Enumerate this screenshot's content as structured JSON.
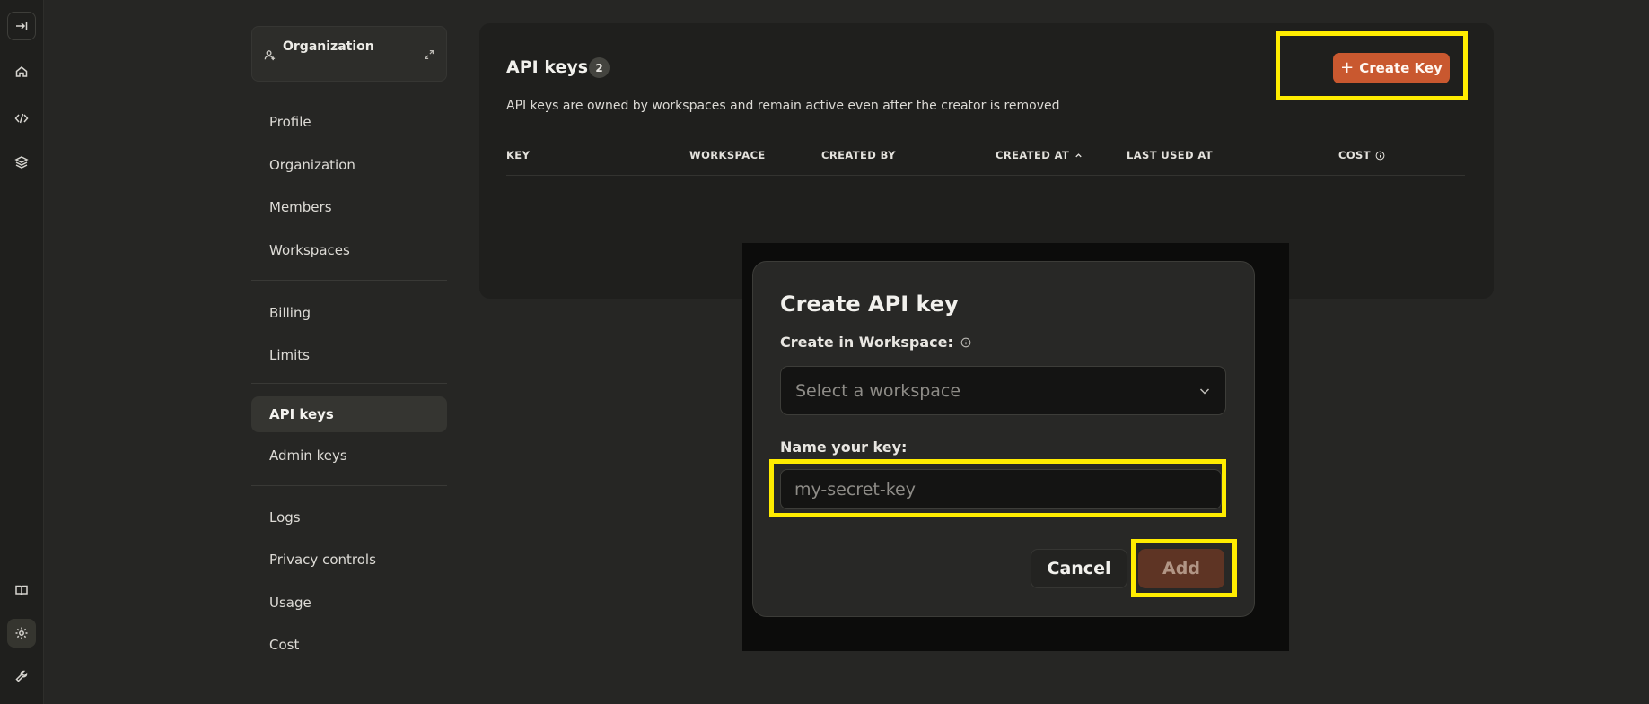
{
  "sidebar": {
    "org_switcher": {
      "name": "Organization"
    },
    "items": [
      {
        "label": "Profile"
      },
      {
        "label": "Organization"
      },
      {
        "label": "Members"
      },
      {
        "label": "Workspaces"
      },
      {
        "label": "Billing"
      },
      {
        "label": "Limits"
      },
      {
        "label": "API keys",
        "active": true
      },
      {
        "label": "Admin keys"
      },
      {
        "label": "Logs"
      },
      {
        "label": "Privacy controls"
      },
      {
        "label": "Usage"
      },
      {
        "label": "Cost"
      }
    ]
  },
  "rail": {
    "icons": [
      "expand-sidebar-icon",
      "home-icon",
      "code-icon",
      "layers-icon",
      "book-icon",
      "settings-icon",
      "wrench-icon"
    ]
  },
  "main": {
    "title": "API keys",
    "count": "2",
    "description": "API keys are owned by workspaces and remain active even after the creator is removed",
    "create_button": "Create Key",
    "columns": [
      "KEY",
      "WORKSPACE",
      "CREATED BY",
      "CREATED AT",
      "LAST USED AT",
      "COST"
    ]
  },
  "modal": {
    "title": "Create API key",
    "workspace_label": "Create in Workspace:",
    "workspace_placeholder": "Select a workspace",
    "name_label": "Name your key:",
    "name_placeholder": "my-secret-key",
    "cancel_label": "Cancel",
    "add_label": "Add"
  },
  "colors": {
    "accent": "#c9582f",
    "highlight": "#ffec00",
    "background": "#262624"
  }
}
